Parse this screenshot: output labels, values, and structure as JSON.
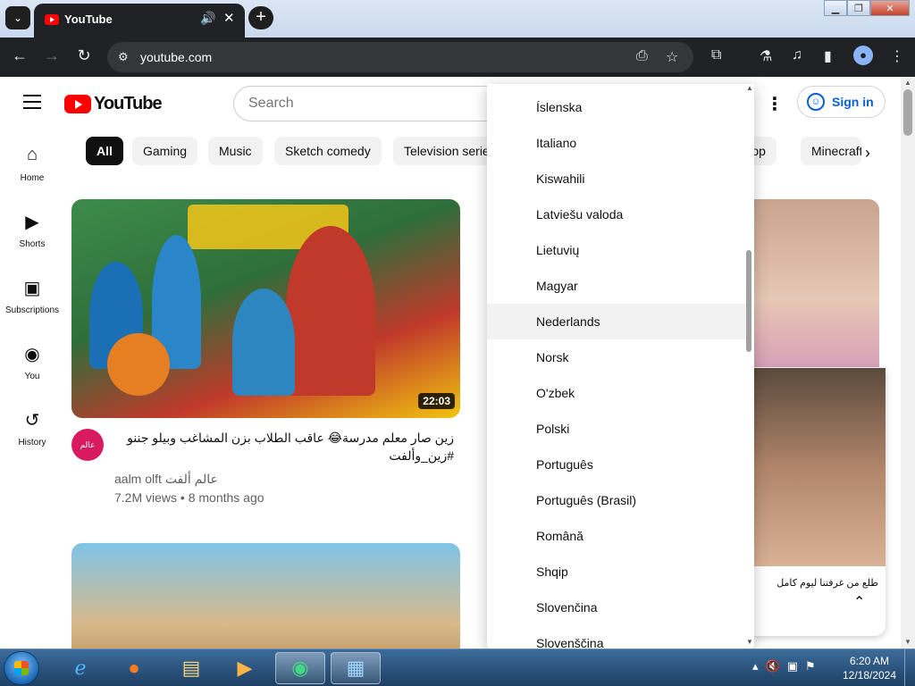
{
  "browser": {
    "tab_title": "YouTube",
    "url": "youtube.com",
    "new_tab_symbol": "+",
    "close_symbol": "✕",
    "audio_symbol": "🔊"
  },
  "youtube": {
    "logo_text": "YouTube",
    "search_placeholder": "Search",
    "sign_in": "Sign in",
    "chips": [
      "All",
      "Gaming",
      "Music",
      "Sketch comedy",
      "Television series",
      "K-Pop",
      "Minecraft"
    ],
    "guide": [
      {
        "label": "Home",
        "icon": "home-icon"
      },
      {
        "label": "Shorts",
        "icon": "shorts-icon"
      },
      {
        "label": "Subscriptions",
        "icon": "subscriptions-icon"
      },
      {
        "label": "You",
        "icon": "you-icon"
      },
      {
        "label": "History",
        "icon": "history-icon"
      }
    ],
    "video1": {
      "duration": "22:03",
      "title": "زين صار معلم مدرسة😂 عاقب الطلاب بزن المشاغب وبيلو جننو  #زين_وألفت",
      "channel": "aalm olft عالم ألفت",
      "views": "7.2M views • 8 months ago",
      "avatar_text": "عالم ألفت"
    },
    "miniplayer_title": "طلع من غرفتنا ليوم كامل"
  },
  "language_menu": {
    "items": [
      "Íslenska",
      "Italiano",
      "Kiswahili",
      "Latviešu valoda",
      "Lietuvių",
      "Magyar",
      "Nederlands",
      "Norsk",
      "O'zbek",
      "Polski",
      "Português",
      "Português (Brasil)",
      "Română",
      "Shqip",
      "Slovenčina",
      "Slovenščina"
    ],
    "hovered": "Nederlands"
  },
  "taskbar": {
    "time": "6:20 AM",
    "date": "12/18/2024"
  }
}
